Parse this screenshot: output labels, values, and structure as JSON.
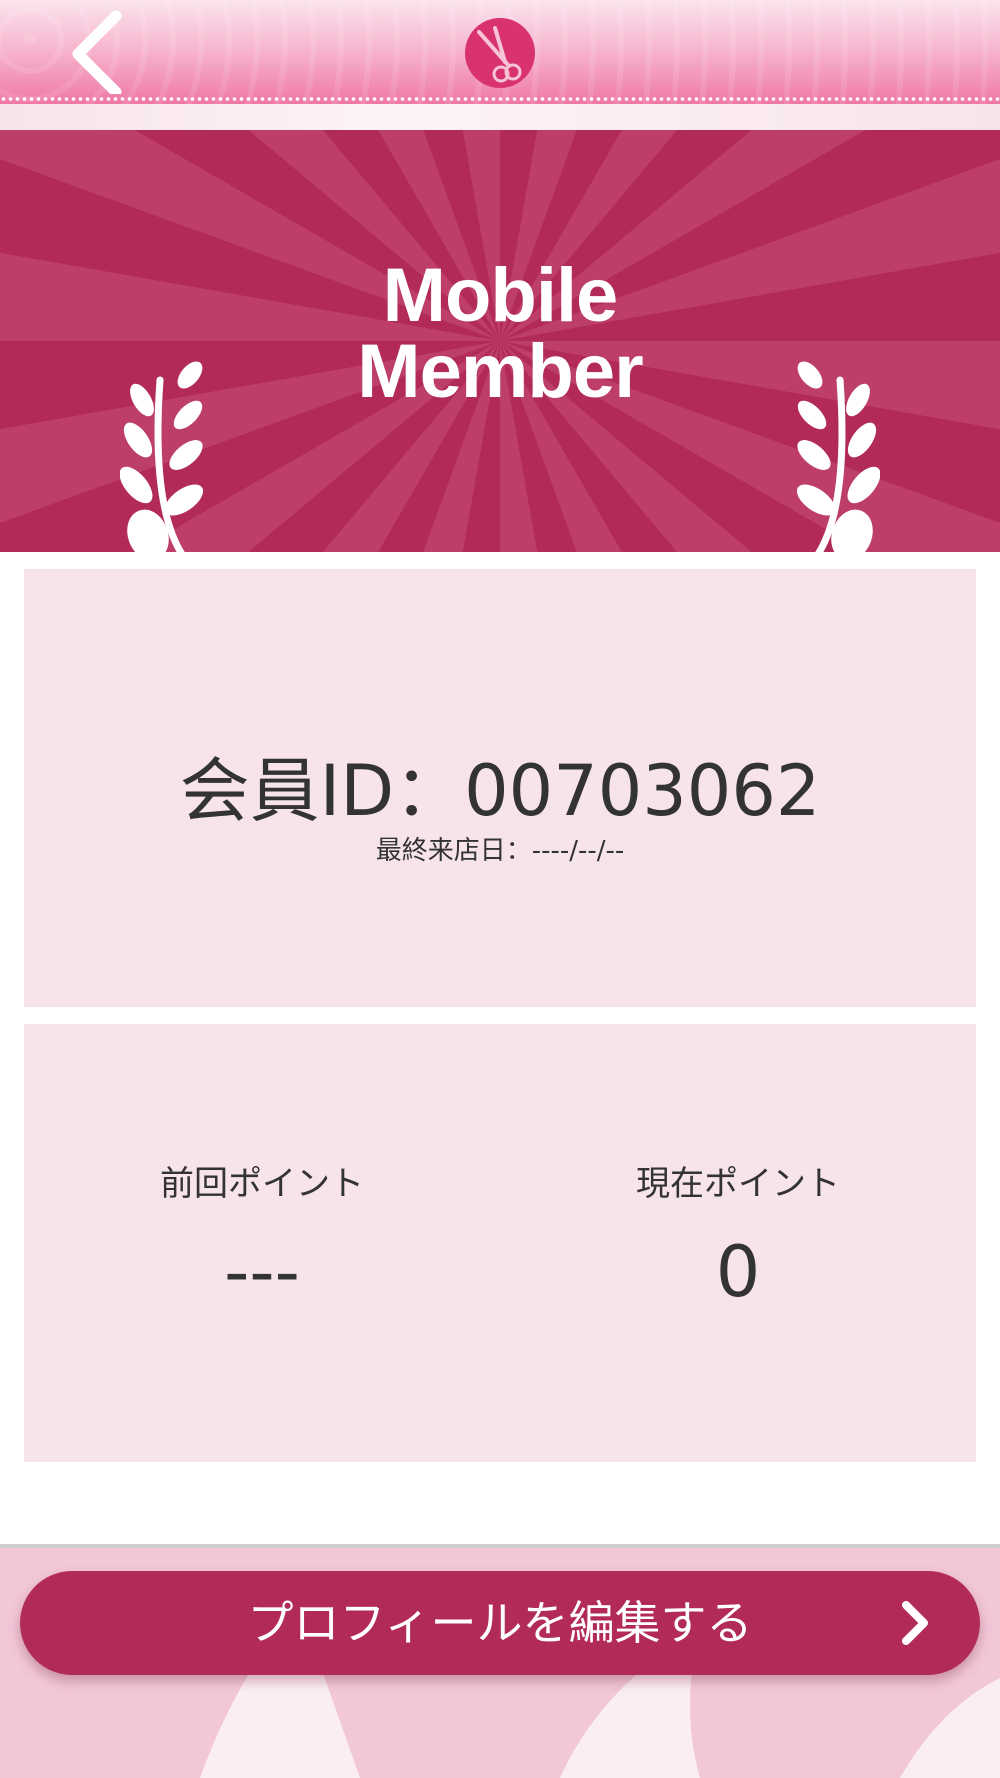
{
  "header": {
    "back_icon": "chevron-left-icon",
    "logo_icon": "scissors-icon"
  },
  "hero": {
    "title_line1": "Mobile",
    "title_line2": "Member",
    "decoration_icon": "laurel-icon"
  },
  "member_card": {
    "member_id_text": "会員ID：00703062",
    "last_visit_text": "最終来店日：----/--/--"
  },
  "points_card": {
    "previous_label": "前回ポイント",
    "previous_value": "---",
    "current_label": "現在ポイント",
    "current_value": "0"
  },
  "footer": {
    "edit_profile_label": "プロフィールを編集する",
    "edit_profile_icon": "chevron-right-icon"
  },
  "colors": {
    "primary": "#b22a5a",
    "card_background": "#f7e4eb",
    "header_pink": "#ef78a6",
    "text": "#333333"
  }
}
